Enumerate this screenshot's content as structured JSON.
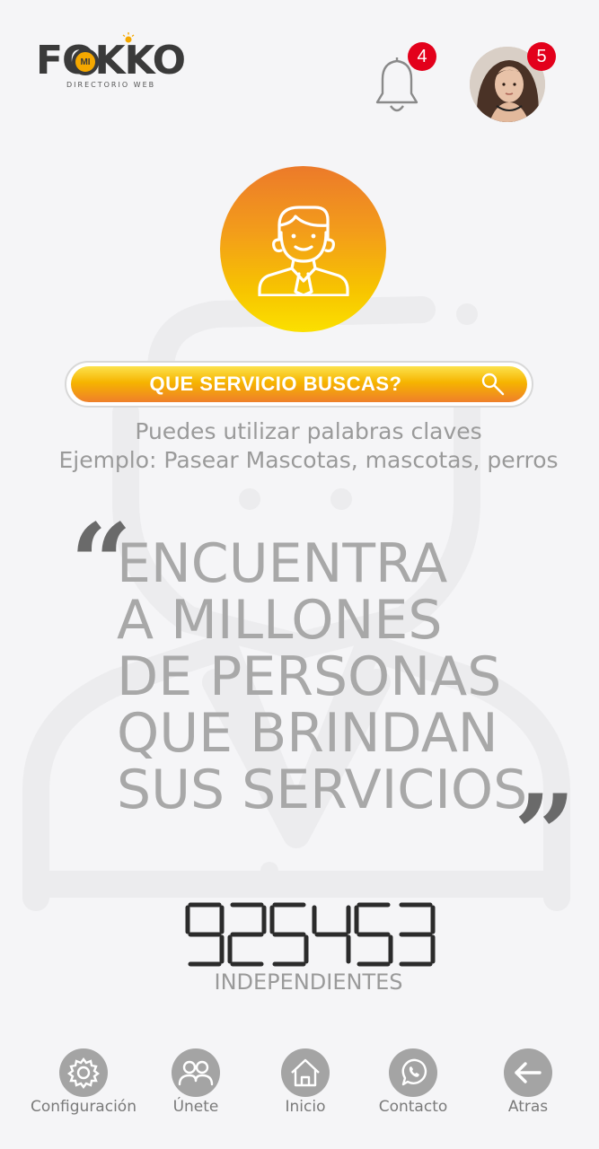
{
  "header": {
    "logo": {
      "brand": "FOKKO",
      "badge": "MI",
      "tagline": "DIRECTORIO WEB"
    },
    "notifications": {
      "icon": "bell-icon",
      "count": "4"
    },
    "profile": {
      "icon": "avatar",
      "count": "5"
    }
  },
  "hero": {
    "icon": "user-icon"
  },
  "search": {
    "label": "QUE SERVICIO BUSCAS?",
    "icon": "search-icon"
  },
  "hint": {
    "line1": "Puedes utilizar palabras claves",
    "line2": "Ejemplo: Pasear Mascotas, mascotas, perros"
  },
  "slogan": {
    "lines": [
      "ENCUENTRA",
      "A MILLONES",
      "DE PERSONAS",
      "QUE BRINDAN",
      "SUS SERVICIOS"
    ]
  },
  "counter": {
    "value": "925453",
    "label": "INDEPENDIENTES"
  },
  "nav": {
    "items": [
      {
        "label": "Configuración",
        "icon": "gear-icon"
      },
      {
        "label": "Únete",
        "icon": "users-icon"
      },
      {
        "label": "Inicio",
        "icon": "home-icon"
      },
      {
        "label": "Contacto",
        "icon": "whatsapp-icon"
      },
      {
        "label": "Atras",
        "icon": "arrow-left-icon"
      }
    ]
  },
  "colors": {
    "accent_orange": "#ef7f2a",
    "accent_yellow": "#f7c400",
    "badge_red": "#e3001b",
    "nav_grey": "#a4a4a4"
  }
}
